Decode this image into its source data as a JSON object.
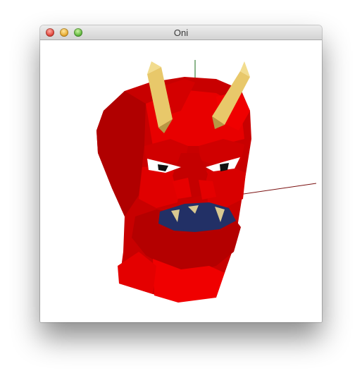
{
  "window": {
    "title": "Oni"
  },
  "traffic_lights": {
    "close": "close-button",
    "minimize": "minimize-button",
    "zoom": "zoom-button"
  },
  "colors": {
    "face_red": "#e80000",
    "face_dark": "#c10000",
    "horn": "#e8c86a",
    "mouth": "#223066",
    "eye_white": "#ffffff"
  }
}
